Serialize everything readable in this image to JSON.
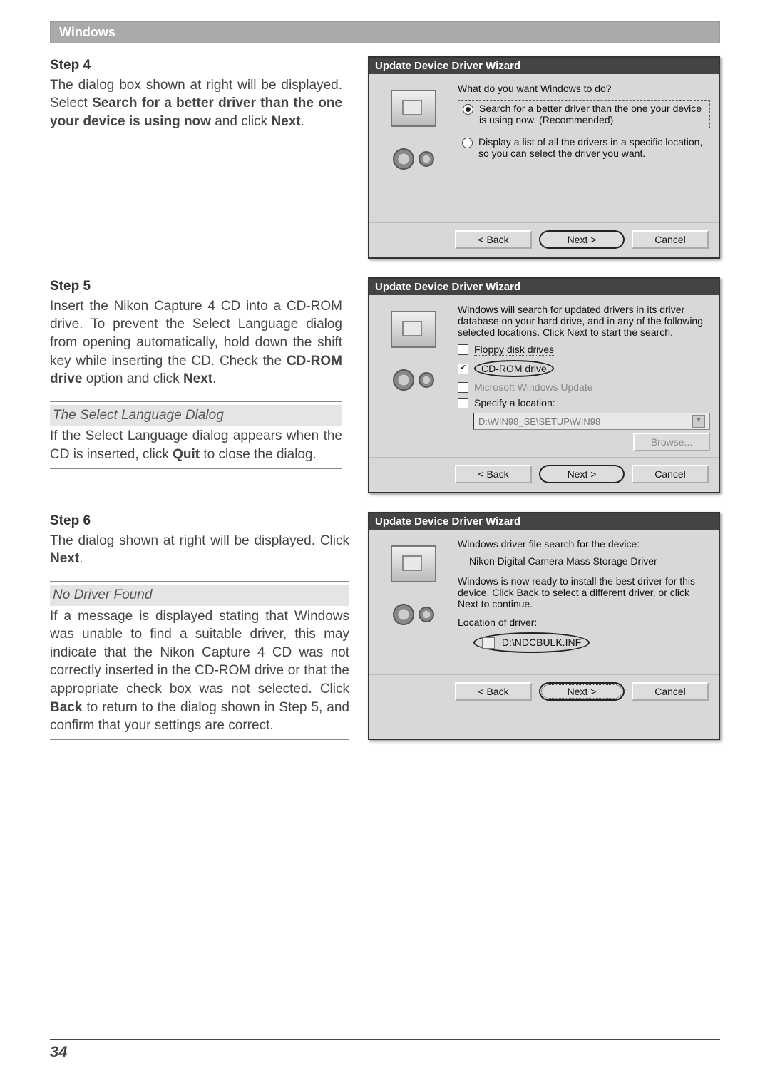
{
  "section_header": "Windows",
  "page_number": "34",
  "step4": {
    "title": "Step 4",
    "body_pre": "The dialog box shown at right will be displayed. Select ",
    "bold1": "Search for a better driver than the one your device is using now",
    "body_mid": " and click ",
    "bold2": "Next",
    "body_post": "."
  },
  "step5": {
    "title": "Step 5",
    "body_pre": "Insert the Nikon Capture 4 CD into a CD-ROM drive.  To prevent the Select Language dialog from opening automatically, hold down the shift key while inserting the CD.  Check the ",
    "bold1": "CD-ROM drive",
    "body_mid": " option and click ",
    "bold2": "Next",
    "body_post": ".",
    "aside_title": "The Select Language Dialog",
    "aside_pre": "If the Select Language dialog appears when the CD is inserted, click ",
    "aside_bold": "Quit",
    "aside_post": " to close the dialog."
  },
  "step6": {
    "title": "Step 6",
    "body_pre": "The dialog shown at right will be displayed. Click ",
    "bold1": "Next",
    "body_post": ".",
    "aside_title": "No Driver Found",
    "aside_pre": "If a message is displayed stating that Windows was unable to find a suitable driver, this may indicate that the Nikon Capture 4 CD was not correctly inserted in the CD-ROM drive or that the appropriate check box was not selected. Click ",
    "aside_bold": "Back",
    "aside_post": " to return to the dialog shown in Step 5, and confirm that your settings are correct."
  },
  "dialog_title": "Update Device Driver Wizard",
  "dlg4": {
    "heading": "What do you want Windows to do?",
    "opt1": "Search for a better driver than the one your device is using now. (Recommended)",
    "opt2": "Display a list of all the drivers in a specific location, so you can select the driver you want."
  },
  "dlg5": {
    "heading": "Windows will search for updated drivers in its driver database on your hard drive, and in any of the following selected locations. Click Next to start the search.",
    "chk_floppy": "Floppy disk drives",
    "chk_cd": "CD-ROM drive",
    "chk_wu": "Microsoft Windows Update",
    "chk_loc": "Specify a location:",
    "loc_path": "D:\\WIN98_SE\\SETUP\\WIN98",
    "browse": "Browse..."
  },
  "dlg6": {
    "heading": "Windows driver file search for the device:",
    "device": "Nikon Digital Camera Mass Storage Driver",
    "ready": "Windows is now ready to install the best driver for this device. Click Back to select a different driver, or click Next to continue.",
    "loc_label": "Location of driver:",
    "loc_path": "D:\\NDCBULK.INF"
  },
  "buttons": {
    "back": "< Back",
    "next": "Next >",
    "cancel": "Cancel"
  }
}
